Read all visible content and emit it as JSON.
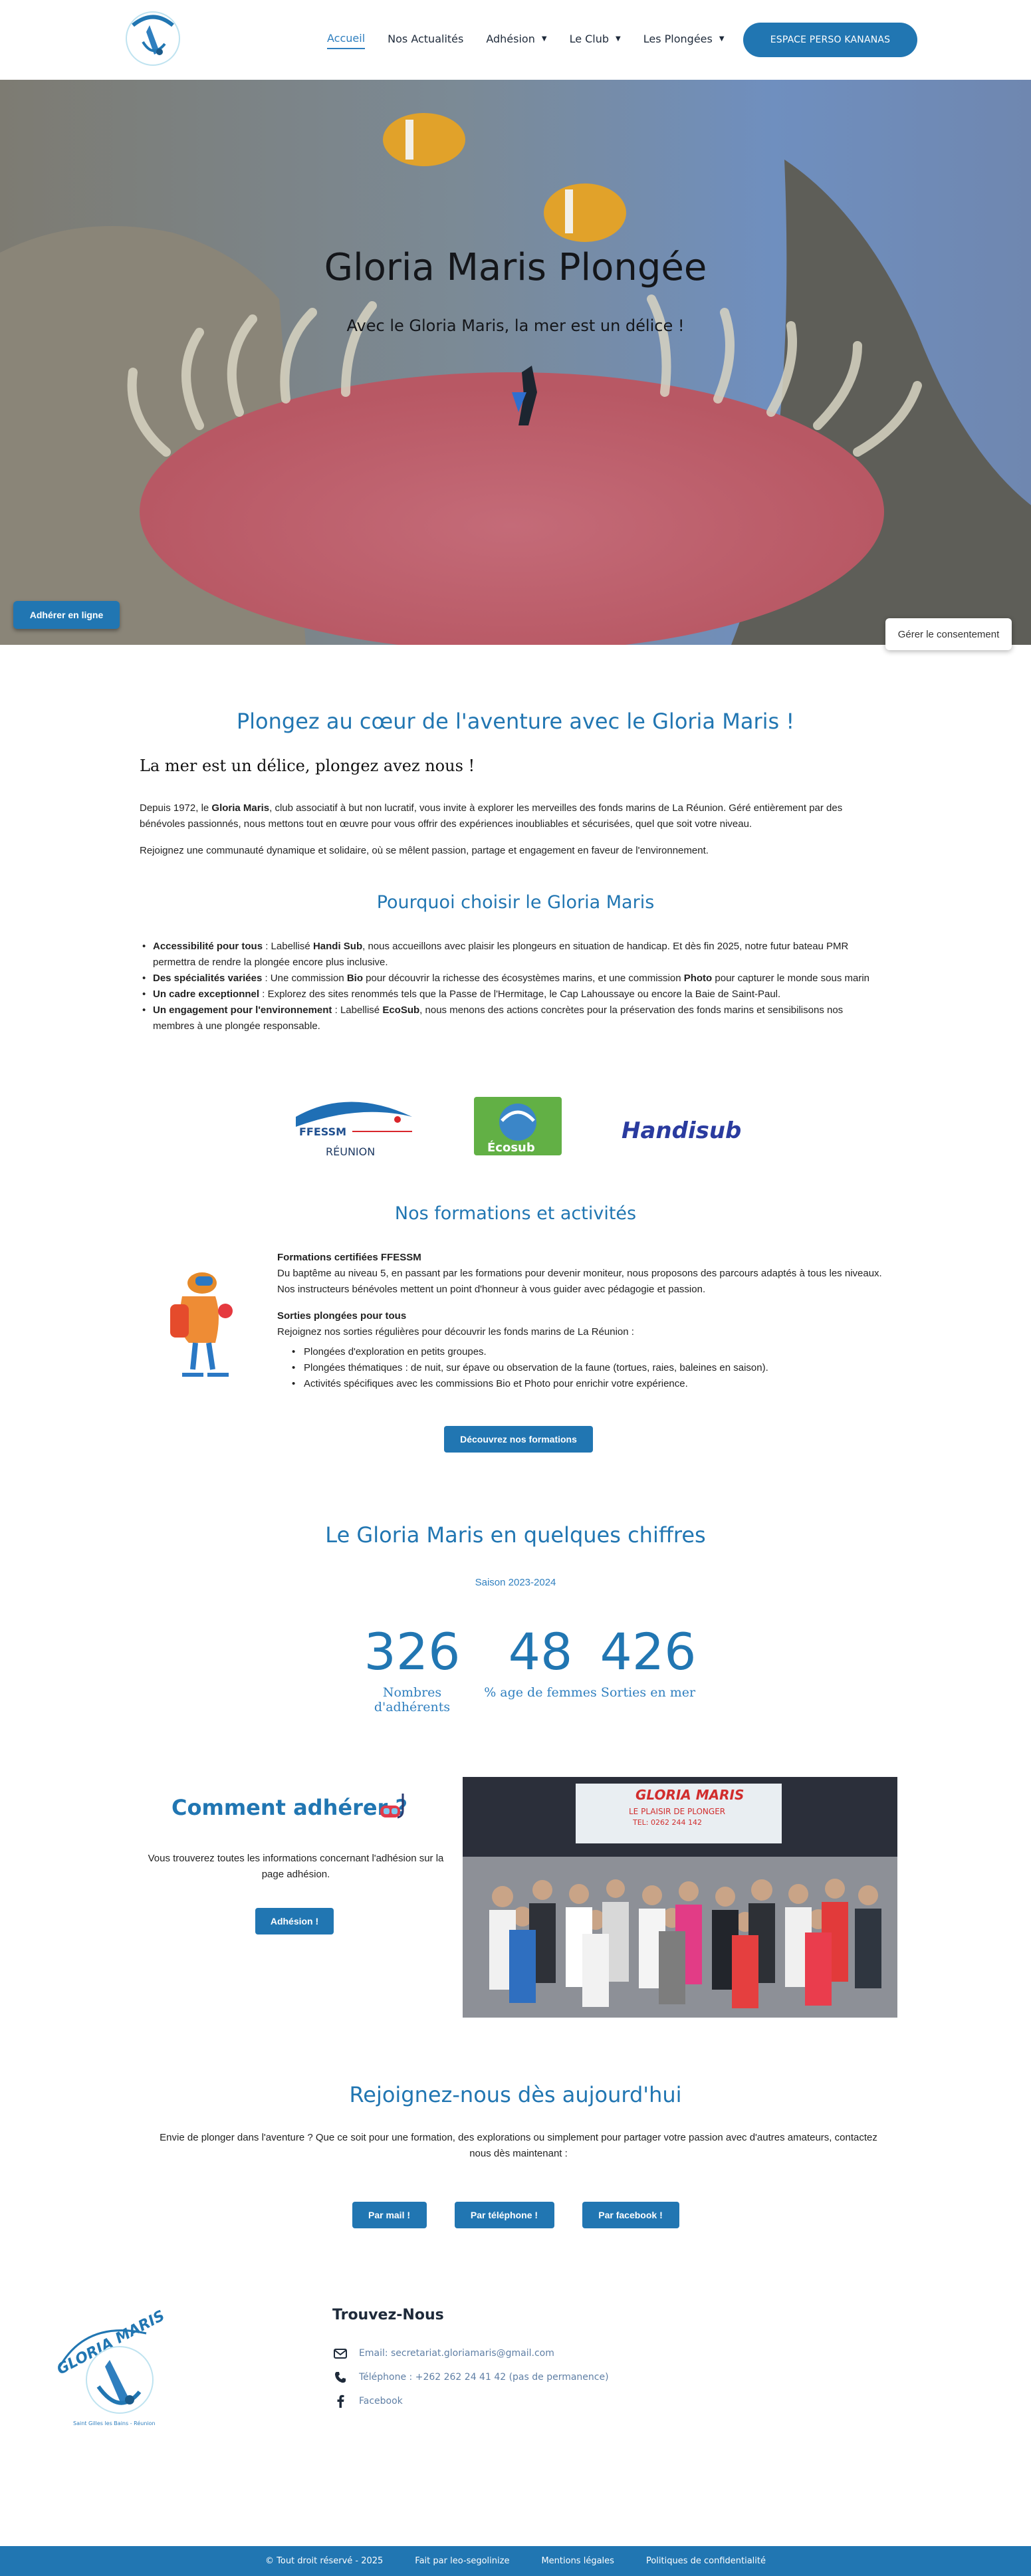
{
  "header": {
    "nav": [
      {
        "label": "Accueil",
        "active": true,
        "dropdown": false
      },
      {
        "label": "Nos Actualités",
        "active": false,
        "dropdown": false
      },
      {
        "label": "Adhésion",
        "active": false,
        "dropdown": true
      },
      {
        "label": "Le Club",
        "active": false,
        "dropdown": true
      },
      {
        "label": "Les Plongées",
        "active": false,
        "dropdown": true
      }
    ],
    "cta": "ESPACE PERSO KANANAS"
  },
  "hero": {
    "title": "Gloria Maris Plongée",
    "subtitle": "Avec le Gloria Maris, la mer est un délice !",
    "adherer_button": "Adhérer en ligne",
    "consent_button": "Gérer le consentement"
  },
  "intro": {
    "title": "Plongez au cœur de l'aventure avec le Gloria Maris !",
    "lead": "La mer est un délice, plongez avez nous !",
    "p1_a": "Depuis 1972, le ",
    "p1_b": "Gloria Maris",
    "p1_c": ", club associatif à but non lucratif, vous invite à explorer les merveilles des fonds marins de La Réunion. Géré entièrement par des bénévoles passionnés, nous mettons tout en œuvre pour vous offrir des expériences inoubliables et sécurisées, quel que soit votre niveau.",
    "p2": "Rejoignez une communauté dynamique et solidaire, où se mêlent passion, partage et engagement en faveur de l'environnement."
  },
  "why": {
    "title": "Pourquoi choisir le Gloria Maris",
    "items": [
      {
        "bold": "Accessibilité pour tous",
        "t1": " : Labellisé ",
        "b2": "Handi Sub",
        "t2": ", nous accueillons avec plaisir les plongeurs en situation de handicap. Et dès fin 2025, notre futur bateau PMR permettra de rendre la plongée encore plus inclusive."
      },
      {
        "bold": "Des spécialités variées",
        "t1": " : Une commission ",
        "b2": "Bio",
        "t2": " pour découvrir la richesse des écosystèmes marins, et une commission ",
        "b3": "Photo",
        "t3": " pour capturer le monde sous marin"
      },
      {
        "bold": "Un cadre exceptionnel",
        "t1": " : Explorez des sites renommés tels que la Passe de l'Hermitage, le Cap Lahoussaye ou encore la Baie de Saint-Paul.",
        "b2": "",
        "t2": ""
      },
      {
        "bold": "Un engagement pour l'environnement",
        "t1": " : Labellisé ",
        "b2": "EcoSub",
        "t2": ", nous menons des actions concrètes pour la préservation des fonds marins et sensibilisons nos membres à une plongée responsable."
      }
    ],
    "logos": {
      "ffessm": "FFESSM",
      "reunion": "RÉUNION",
      "ecosub": "Écosub",
      "handisub": "Handisub"
    }
  },
  "formations": {
    "title": "Nos formations et activités",
    "h1": "Formations certifiées FFESSM",
    "p1": "Du baptême au niveau 5, en passant par les formations pour devenir moniteur, nous proposons des parcours adaptés à tous les niveaux. Nos instructeurs bénévoles mettent un point d'honneur à vous guider avec pédagogie et passion.",
    "h2": "Sorties plongées pour tous",
    "p2": "Rejoignez nos sorties régulières pour découvrir les fonds marins de La Réunion :",
    "list": [
      "Plongées d'exploration en petits groupes.",
      "Plongées thématiques : de nuit, sur épave ou observation de la faune (tortues, raies, baleines en saison).",
      "Activités spécifiques avec les commissions Bio et Photo pour enrichir votre expérience."
    ],
    "button": "Découvrez nos formations"
  },
  "stats": {
    "title": "Le Gloria Maris en quelques chiffres",
    "season": "Saison 2023-2024",
    "items": [
      {
        "value": "326",
        "label": "Nombres d'adhérents"
      },
      {
        "value": "48",
        "label": "% age de femmes"
      },
      {
        "value": "426",
        "label": "Sorties en mer"
      }
    ]
  },
  "adhesion": {
    "title": "Comment adhérer ?",
    "text": "Vous trouverez toutes les informations concernant l'adhésion sur la page adhésion.",
    "button": "Adhésion !",
    "photo_sign_1": "GLORIA MARIS",
    "photo_sign_2": "LE PLAISIR DE PLONGER",
    "photo_sign_3": "TEL: 0262 244 142"
  },
  "join": {
    "title": "Rejoignez-nous dès aujourd'hui",
    "text": "Envie de plonger dans l'aventure ? Que ce soit pour une formation, des explorations ou simplement pour partager votre passion avec d'autres amateurs, contactez nous dès maintenant :",
    "buttons": [
      "Par mail !",
      "Par téléphone !",
      "Par facebook !"
    ]
  },
  "footer": {
    "logo_text": "GLORIA MARIS",
    "logo_sub": "Saint Gilles les Bains - Réunion",
    "title": "Trouvez-Nous",
    "email": "Email: secretariat.gloriamaris@gmail.com",
    "phone": "Téléphone : +262 262 24 41 42 (pas de permanence)",
    "facebook": "Facebook",
    "bottom": [
      "© Tout droit réservé - 2025",
      "Fait par leo-segolinize",
      "Mentions légales",
      "Politiques de confidentialité"
    ]
  },
  "colors": {
    "primary": "#2176b2",
    "accent": "#2f7fbf"
  }
}
